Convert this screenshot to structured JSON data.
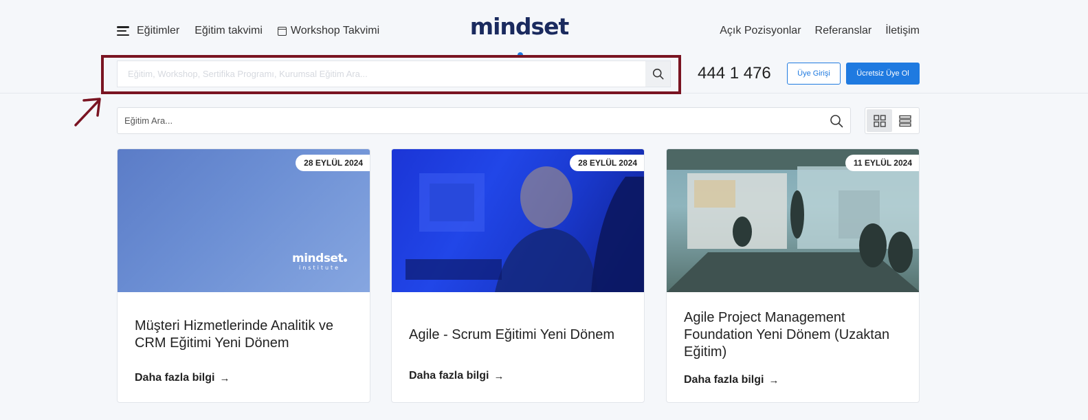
{
  "header": {
    "nav_left": {
      "trainings": "Eğitimler",
      "training_calendar": "Eğitim takvimi",
      "workshop_calendar": "Workshop Takvimi"
    },
    "logo": {
      "word": "mindset",
      "sub": "institute"
    },
    "nav_right": {
      "positions": "Açık Pozisyonlar",
      "references": "Referanslar",
      "contact": "İletişim"
    },
    "search": {
      "placeholder": "Eğitim, Workshop, Sertifika Programı, Kurumsal Eğitim Ara..."
    },
    "phone": "444 1 476",
    "login_label": "Üye Girişi",
    "signup_label": "Ücretsiz Üye Ol"
  },
  "main": {
    "search": {
      "placeholder": "Eğitim Ara..."
    },
    "view_mode": "grid",
    "cards": [
      {
        "date": "28 EYLÜL 2024",
        "title": "Müşteri Hizmetlerinde Analitik ve CRM Eğitimi Yeni Dönem",
        "more": "Daha fazla bilgi",
        "image_logo": "mindset",
        "image_logo_sub": "institute"
      },
      {
        "date": "28 EYLÜL 2024",
        "title": "Agile - Scrum Eğitimi Yeni Dönem",
        "more": "Daha fazla bilgi"
      },
      {
        "date": "11 EYLÜL 2024",
        "title": "Agile Project Management Foundation Yeni Dönem (Uzaktan Eğitim)",
        "more": "Daha fazla bilgi"
      }
    ]
  },
  "colors": {
    "accent": "#1f7ae0",
    "brand_navy": "#1a2a5e",
    "highlight": "#7a1422",
    "background": "#f5f7fa"
  }
}
